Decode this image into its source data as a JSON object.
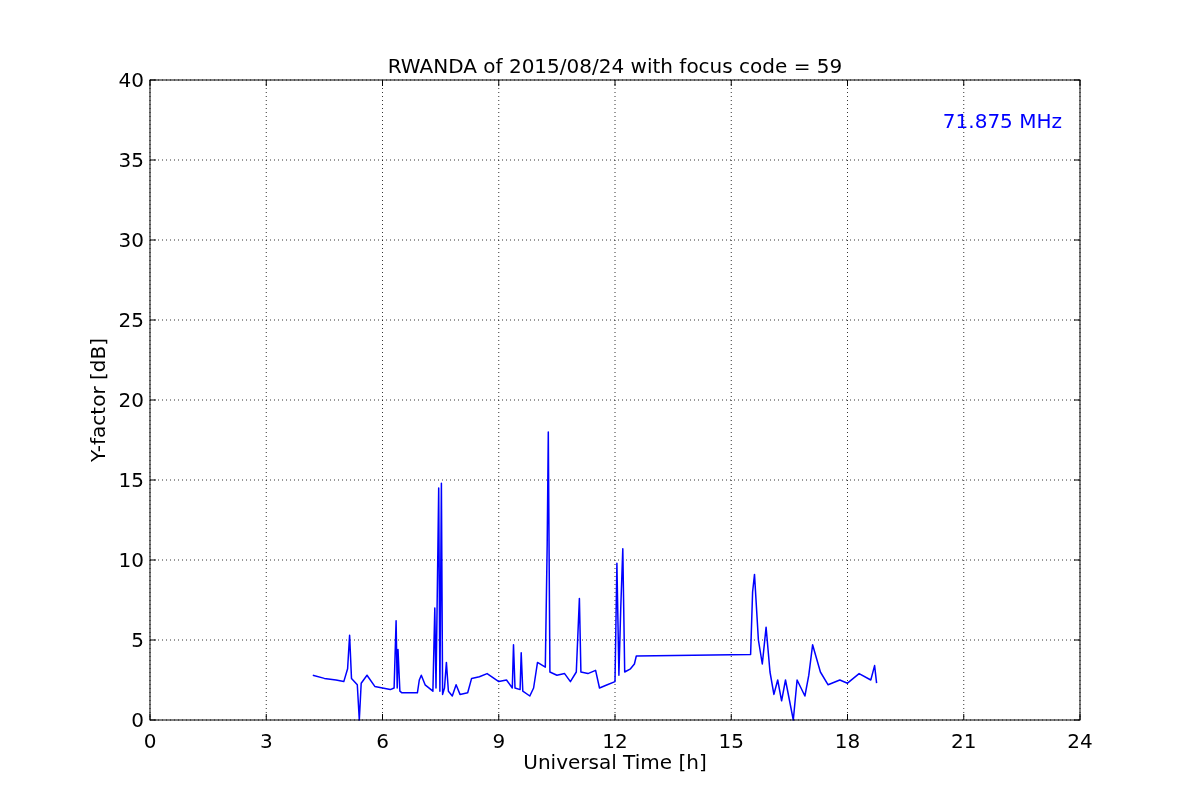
{
  "figure": {
    "chart_data": {
      "type": "line",
      "title": "RWANDA of 2015/08/24 with focus code = 59",
      "xlabel": "Universal Time [h]",
      "ylabel": "Y-factor [dB]",
      "xlim": [
        0,
        24
      ],
      "ylim": [
        0,
        40
      ],
      "xticks": [
        0,
        3,
        6,
        9,
        12,
        15,
        18,
        21,
        24
      ],
      "yticks": [
        0,
        5,
        10,
        15,
        20,
        25,
        30,
        35,
        40
      ],
      "x": [
        4.2,
        4.5,
        4.8,
        5.0,
        5.1,
        5.15,
        5.2,
        5.35,
        5.4,
        5.45,
        5.6,
        5.8,
        6.0,
        6.2,
        6.3,
        6.35,
        6.38,
        6.4,
        6.45,
        6.5,
        6.9,
        6.95,
        7.0,
        7.1,
        7.3,
        7.35,
        7.38,
        7.45,
        7.48,
        7.52,
        7.55,
        7.6,
        7.65,
        7.7,
        7.8,
        7.9,
        8.0,
        8.2,
        8.3,
        8.5,
        8.7,
        9.0,
        9.2,
        9.35,
        9.38,
        9.42,
        9.55,
        9.58,
        9.62,
        9.8,
        9.9,
        10.0,
        10.2,
        10.25,
        10.28,
        10.32,
        10.5,
        10.7,
        10.85,
        11.0,
        11.08,
        11.12,
        11.3,
        11.5,
        11.6,
        11.8,
        12.0,
        12.05,
        12.1,
        12.15,
        12.2,
        12.25,
        12.4,
        12.5,
        12.55,
        15.5,
        15.55,
        15.6,
        15.7,
        15.8,
        15.9,
        16.0,
        16.1,
        16.2,
        16.3,
        16.4,
        16.6,
        16.7,
        16.9,
        17.0,
        17.1,
        17.3,
        17.5,
        17.8,
        18.0,
        18.3,
        18.6,
        18.7,
        18.75
      ],
      "series": [
        {
          "color": "#0000ff",
          "values": [
            2.8,
            2.6,
            2.5,
            2.4,
            3.2,
            5.3,
            2.6,
            2.2,
            0,
            2.3,
            2.8,
            2.1,
            2.0,
            1.9,
            2.0,
            6.2,
            2.0,
            4.4,
            1.8,
            1.7,
            1.7,
            2.5,
            2.8,
            2.2,
            1.8,
            7.0,
            2.0,
            14.5,
            1.8,
            14.8,
            1.6,
            2.0,
            3.6,
            1.8,
            1.5,
            2.2,
            1.6,
            1.7,
            2.6,
            2.7,
            2.9,
            2.4,
            2.5,
            2.0,
            4.7,
            2.0,
            1.9,
            4.2,
            1.8,
            1.5,
            2.0,
            3.6,
            3.3,
            11.0,
            18.0,
            3.0,
            2.8,
            2.9,
            2.4,
            3.0,
            7.6,
            3.0,
            2.9,
            3.1,
            2.0,
            2.2,
            2.4,
            9.8,
            2.8,
            7.1,
            10.7,
            3.0,
            3.2,
            3.5,
            4.0,
            4.1,
            8.0,
            9.1,
            5.0,
            3.5,
            5.8,
            3.0,
            1.6,
            2.5,
            1.2,
            2.5,
            0,
            2.5,
            1.5,
            2.8,
            4.7,
            3.0,
            2.2,
            2.5,
            2.3,
            2.9,
            2.5,
            3.4,
            2.3
          ]
        }
      ],
      "grid": true,
      "annotations": [
        {
          "text": "71.875 MHz"
        }
      ]
    }
  }
}
